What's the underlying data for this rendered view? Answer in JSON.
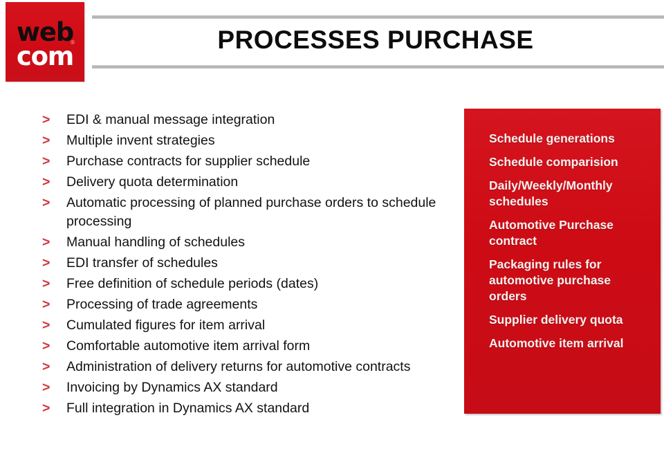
{
  "slide": {
    "title": "PROCESSES PURCHASE",
    "logo": {
      "name": "webcom-logo",
      "line1": "web",
      "line2": "com",
      "registered_mark": "®"
    },
    "bullet_marker": ">",
    "colors": {
      "brand_red": "#ce0d17",
      "logo_red": "#d20a14",
      "bullet_marker_red": "#d3363f",
      "rule_gray": "#b7b7b7",
      "title_black": "#0d0d0d",
      "panel_text_white": "#f7f2f0"
    },
    "bullets": [
      "EDI & manual message integration",
      "Multiple invent strategies",
      "Purchase contracts for supplier schedule",
      "Delivery quota determination",
      "Automatic processing of planned purchase orders to schedule processing",
      "Manual handling of schedules",
      "EDI transfer of schedules",
      "Free definition of schedule periods (dates)",
      "Processing of trade agreements",
      "Cumulated figures for item arrival",
      "Comfortable automotive item arrival form",
      "Administration of delivery returns for automotive contracts",
      "Invoicing by Dynamics AX standard",
      "Full integration in Dynamics AX standard"
    ],
    "red_panel": {
      "items": [
        "Schedule generations",
        "Schedule comparision",
        "Daily/Weekly/Monthly schedules",
        "Automotive Purchase contract",
        "Packaging rules for automotive purchase orders",
        "Supplier delivery quota",
        "Automotive item arrival"
      ]
    }
  }
}
